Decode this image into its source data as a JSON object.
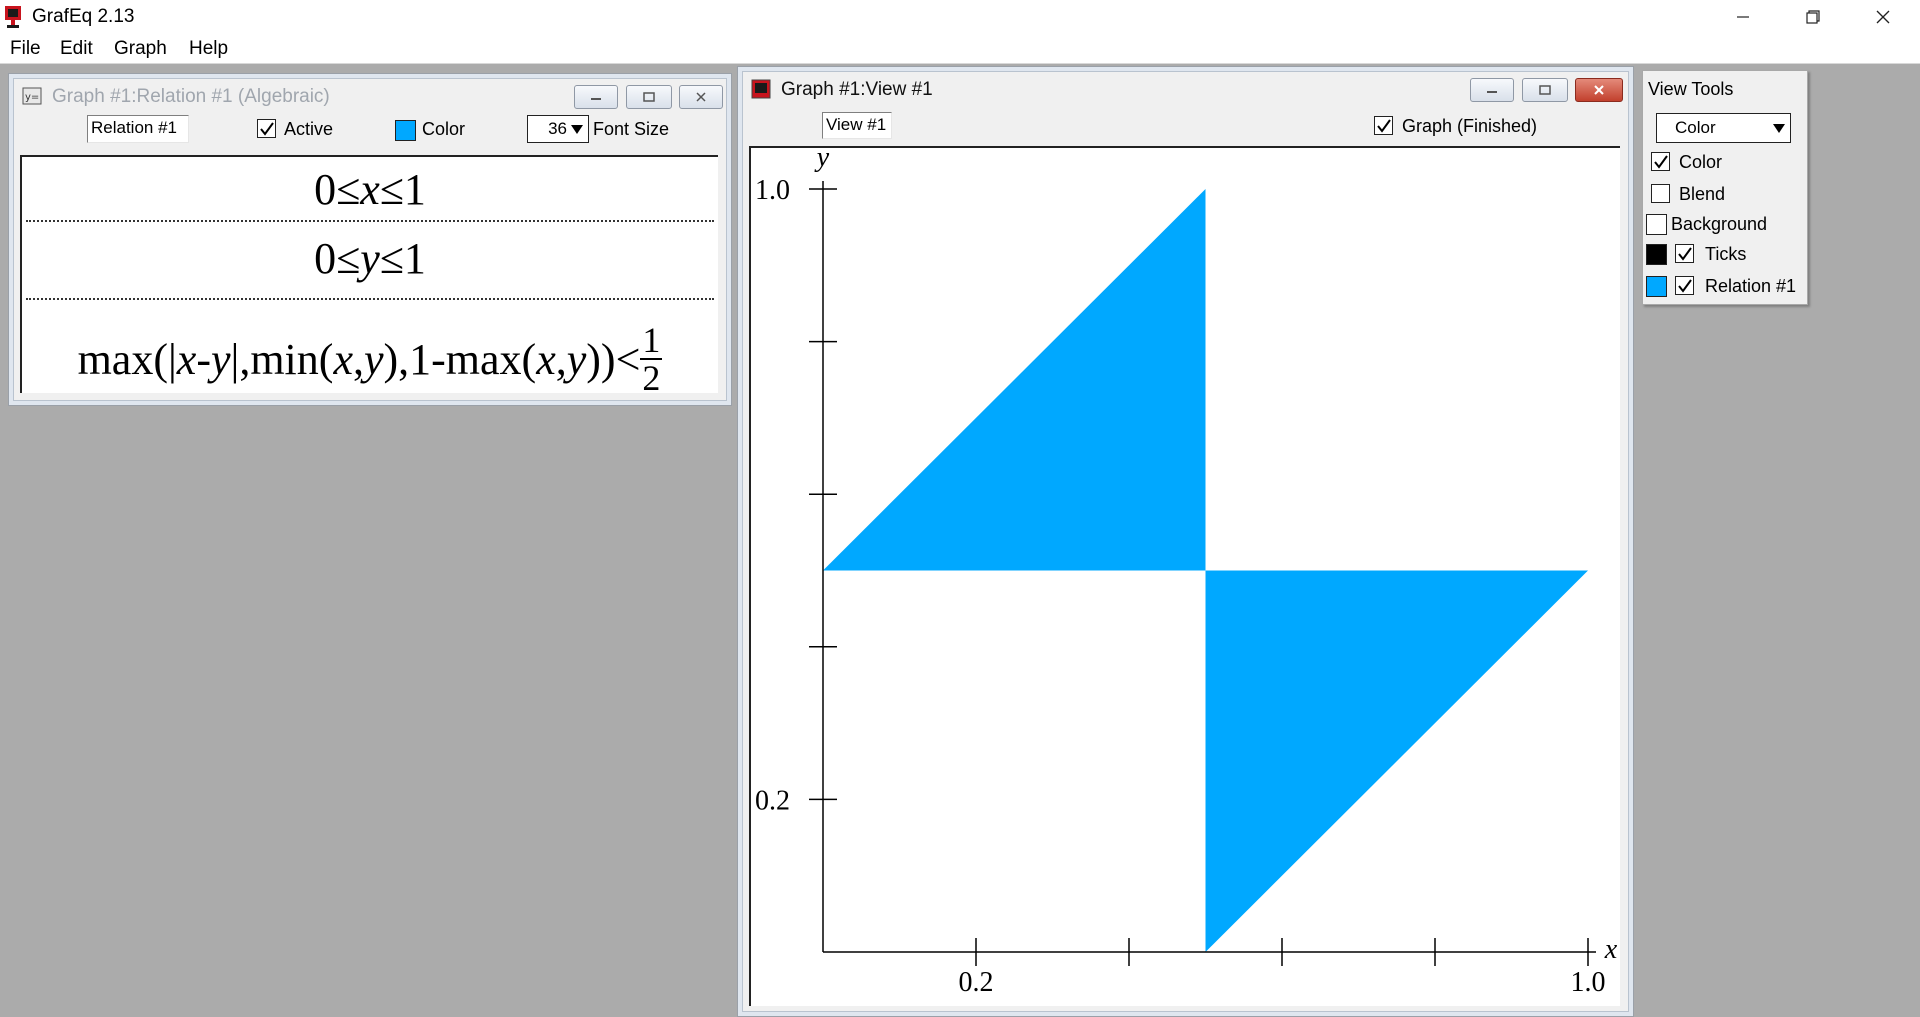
{
  "app": {
    "title": "GrafEq 2.13",
    "menu": [
      "File",
      "Edit",
      "Graph",
      "Help"
    ]
  },
  "relation_window": {
    "title": "Graph #1:Relation #1 (Algebraic)",
    "name_value": "Relation #1",
    "active_label": "Active",
    "active_checked": true,
    "color_label": "Color",
    "color": "#00a8ff",
    "font_size_value": "36",
    "font_size_label": "Font Size",
    "equations": {
      "eq1_left": "0≤",
      "eq1_var": "x",
      "eq1_right": "≤1",
      "eq2_left": "0≤",
      "eq2_var": "y",
      "eq2_right": "≤1",
      "eq3_a": "max(|",
      "eq3_x1": "x",
      "eq3_minus": "-",
      "eq3_y1": "y",
      "eq3_b": "|,min(",
      "eq3_x2": "x",
      "eq3_comma1": ",",
      "eq3_y2": "y",
      "eq3_c": "),1-max(",
      "eq3_x3": "x",
      "eq3_comma2": ",",
      "eq3_y3": "y",
      "eq3_d": "))<",
      "frac_num": "1",
      "frac_den": "2"
    }
  },
  "view_window": {
    "title": "Graph #1:View #1",
    "name_value": "View #1",
    "status_label": "Graph (Finished)",
    "status_checked": true,
    "axis_x_label": "x",
    "axis_y_label": "y",
    "x_tick_labels": [
      "0.2",
      "1.0"
    ],
    "y_tick_labels": [
      "1.0",
      "0.2"
    ],
    "fill_color": "#00a8ff"
  },
  "chart_data": {
    "type": "area",
    "title": "",
    "xlabel": "x",
    "ylabel": "y",
    "xlim": [
      0,
      1
    ],
    "ylim": [
      0,
      1
    ],
    "x_ticks": [
      0.2,
      0.4,
      0.6,
      0.8,
      1.0
    ],
    "y_ticks": [
      0.2,
      0.4,
      0.6,
      0.8,
      1.0
    ],
    "x_tick_labels_shown": [
      "0.2",
      "1.0"
    ],
    "y_tick_labels_shown": [
      "1.0",
      "0.2"
    ],
    "grid": false,
    "regions": [
      {
        "polygon": [
          [
            0,
            0.5
          ],
          [
            0.5,
            1.0
          ],
          [
            0.5,
            0.5
          ]
        ]
      },
      {
        "polygon": [
          [
            0.5,
            0.5
          ],
          [
            1.0,
            0.5
          ],
          [
            0.5,
            0.0
          ]
        ]
      }
    ],
    "color": "#00a8ff"
  },
  "view_tools": {
    "title": "View Tools",
    "dropdown_value": "Color",
    "color_label": "Color",
    "color_checked": true,
    "blend_label": "Blend",
    "blend_checked": false,
    "background_label": "Background",
    "background_color": "#ffffff",
    "ticks_label": "Ticks",
    "ticks_checked": true,
    "ticks_color": "#000000",
    "relation_label": "Relation #1",
    "relation_checked": true,
    "relation_color": "#00a8ff"
  }
}
